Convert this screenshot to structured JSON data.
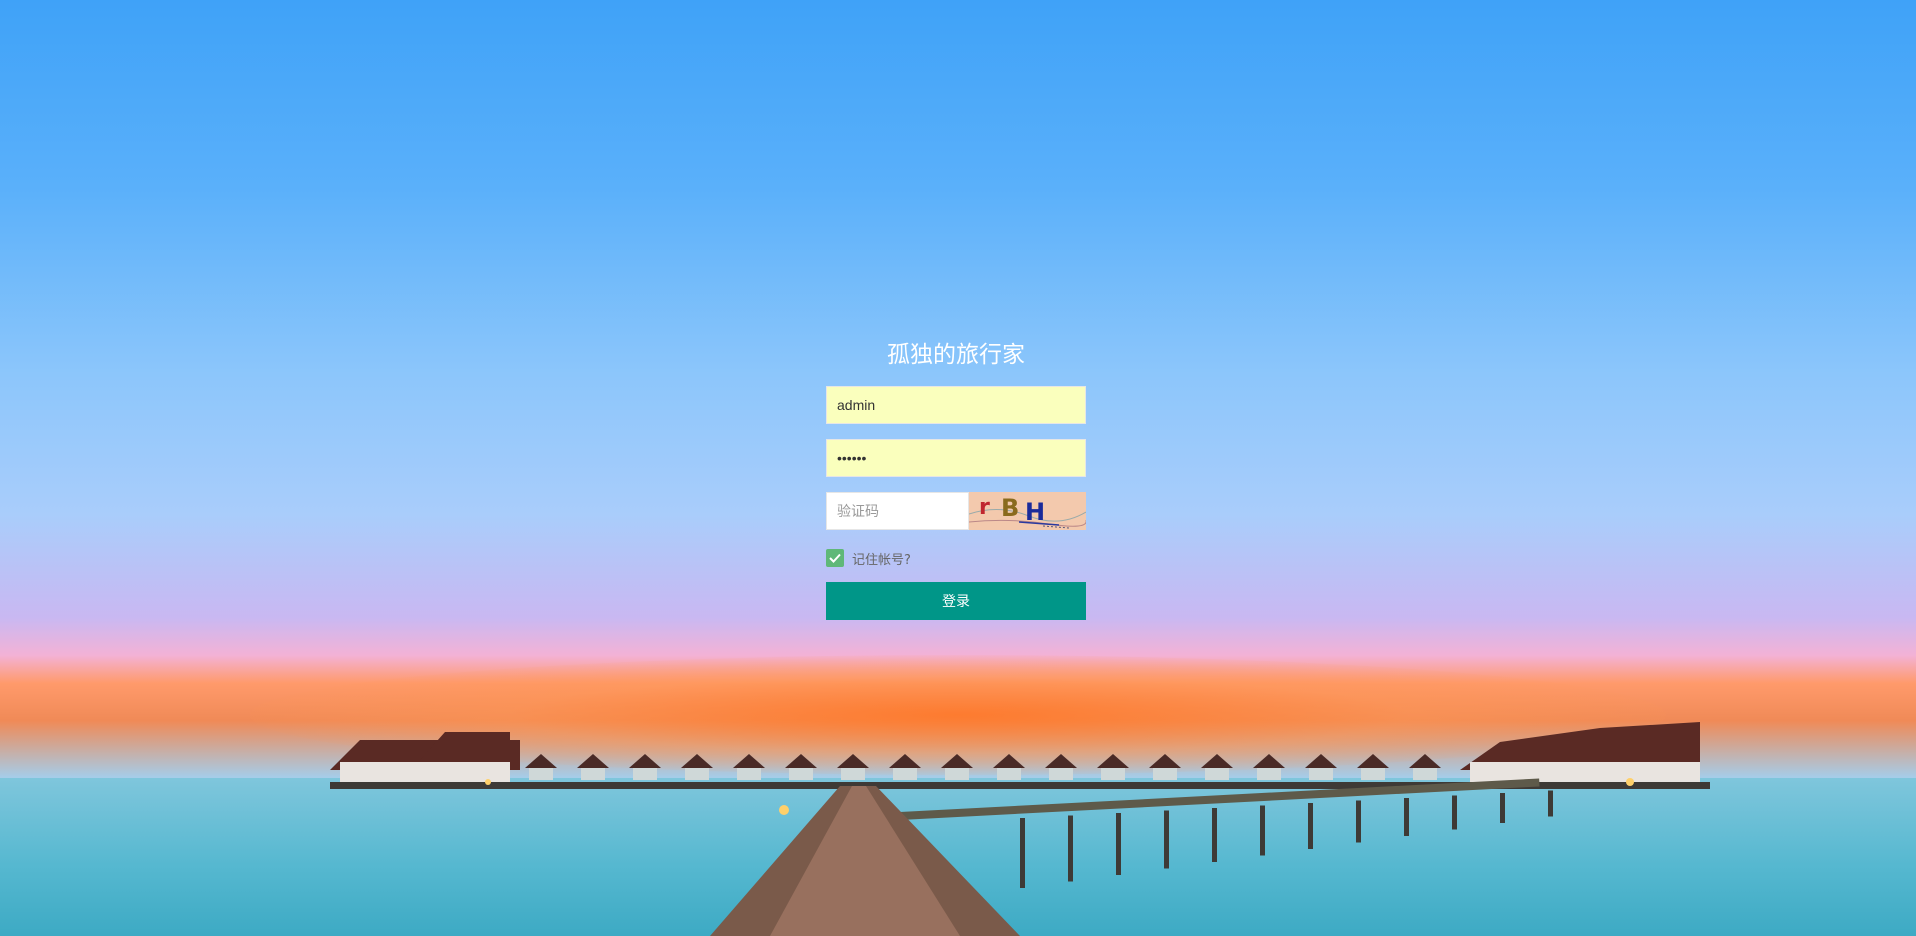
{
  "login": {
    "title": "孤独的旅行家",
    "username_value": "admin",
    "password_value": "••••••",
    "captcha_placeholder": "验证码",
    "captcha_text": "rBH",
    "remember_label": "记住帐号?",
    "remember_checked": true,
    "submit_label": "登录"
  },
  "colors": {
    "button": "#009688",
    "checkbox": "#5fb878",
    "autofill": "#faffbd"
  }
}
